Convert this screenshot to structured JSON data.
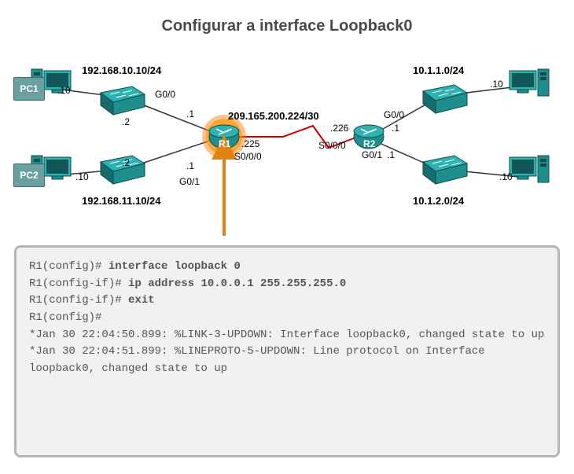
{
  "title": "Configurar a interface Loopback0",
  "networks": {
    "left_top": "192.168.10.10/24",
    "left_bot": "192.168.11.10/24",
    "right_top": "10.1.1.0/24",
    "right_bot": "10.1.2.0/24",
    "wan": "209.165.200.224/30"
  },
  "hosts": {
    "pc1": "PC1",
    "pc2": "PC2",
    "r1": "R1",
    "r2": "R2"
  },
  "ip_labels": {
    "pc1": ".10",
    "pc2": ".10",
    "pc3": ".10",
    "pc4": ".10",
    "sw1_to_r1": ".2",
    "sw2_to_r1": ".2",
    "r1_g00": ".1",
    "r1_g01": ".1",
    "r2_g00": ".1",
    "r2_g01": ".1",
    "r1_s": ".225",
    "r2_s": ".226"
  },
  "if_labels": {
    "g00": "G0/0",
    "g01": "G0/1",
    "s000": "S0/0/0"
  },
  "terminal": {
    "p1": "R1(config)# ",
    "c1": "interface loopback 0",
    "p2": "R1(config-if)# ",
    "c2": "ip address 10.0.0.1 255.255.255.0",
    "p3": "R1(config-if)# ",
    "c3": "exit",
    "p4": "R1(config)#",
    "l1": "*Jan 30 22:04:50.899: %LINK-3-UPDOWN: Interface loopback0, changed state to up",
    "l2": "*Jan 30 22:04:51.899: %LINEPROTO-5-UPDOWN: Line protocol on Interface loopback0, changed state to up"
  }
}
